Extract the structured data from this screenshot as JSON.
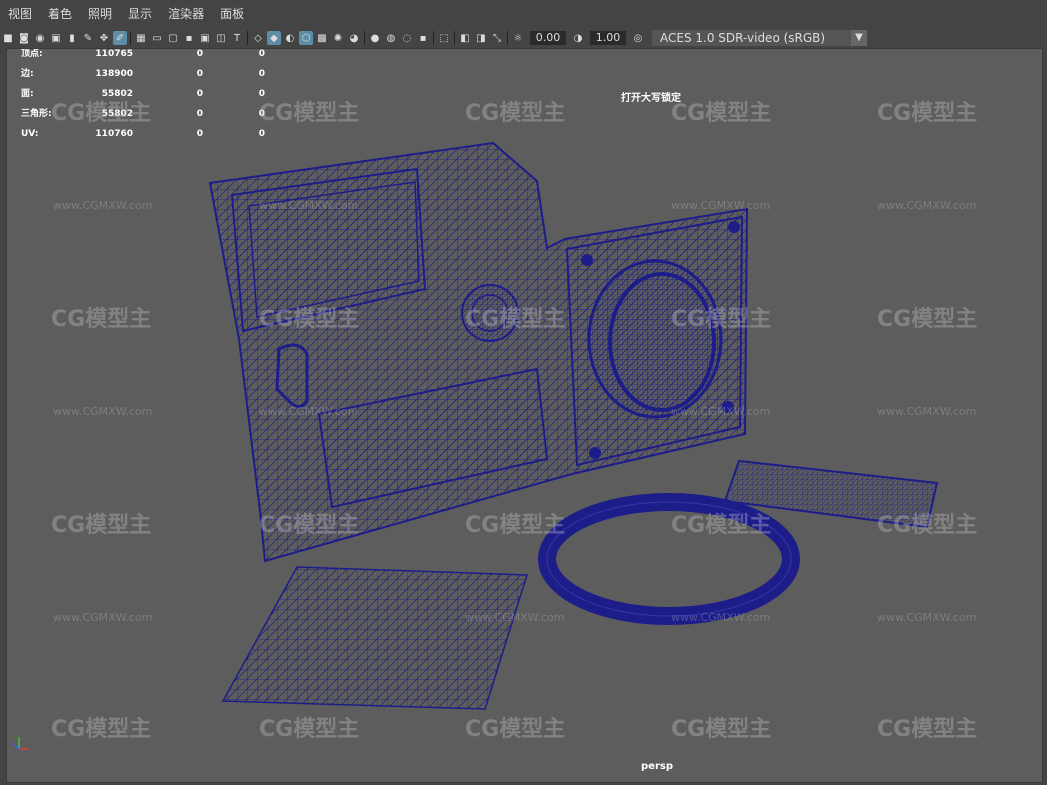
{
  "menu": [
    "视图",
    "着色",
    "照明",
    "显示",
    "渲染器",
    "面板"
  ],
  "toolbar": {
    "exposure_value": "0.00",
    "gamma_value": "1.00",
    "color_management": "ACES 1.0 SDR-video (sRGB)"
  },
  "hud": {
    "rows": [
      {
        "label": "顶点:",
        "value": "110765",
        "c1": "0",
        "c2": "0"
      },
      {
        "label": "边:",
        "value": "138900",
        "c1": "0",
        "c2": "0"
      },
      {
        "label": "面:",
        "value": "55802",
        "c1": "0",
        "c2": "0"
      },
      {
        "label": "三角形:",
        "value": "55802",
        "c1": "0",
        "c2": "0"
      },
      {
        "label": "UV:",
        "value": "110760",
        "c1": "0",
        "c2": "0"
      }
    ]
  },
  "caps_lock_message": "打开大写锁定",
  "camera_label": "persp",
  "watermark": {
    "text": "CG模型主",
    "url": "www.CGMXW.com"
  },
  "colors": {
    "wire": "#1d1d8a",
    "viewport": "#5d5d5d",
    "accent": "#5c8ea8"
  }
}
